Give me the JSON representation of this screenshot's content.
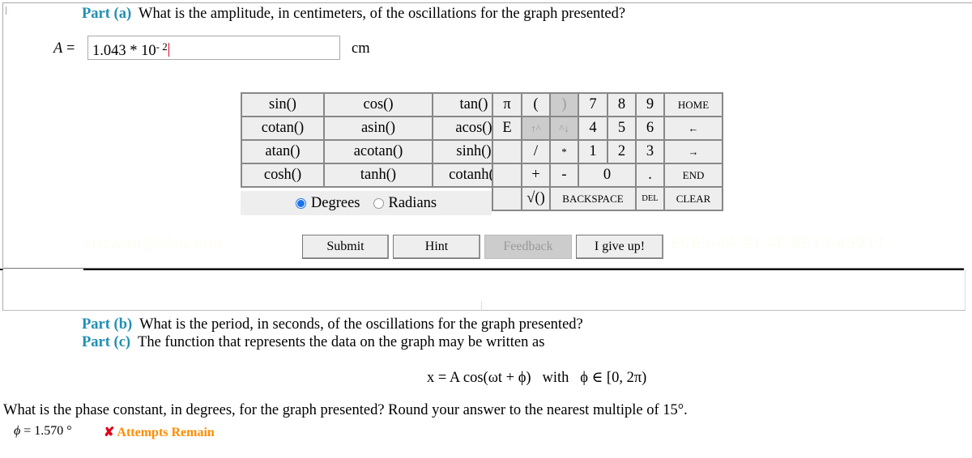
{
  "part_a": {
    "label": "Part (a)",
    "question": "What is the amplitude, in centimeters, of the oscillations for the graph presented?",
    "variable": "A",
    "equals": "=",
    "answer_mantissa": "1.043 * 10",
    "answer_exponent": "- 2",
    "unit": "cm"
  },
  "function_keys": [
    [
      "sin()",
      "cos()",
      "tan()"
    ],
    [
      "cotan()",
      "asin()",
      "acos()"
    ],
    [
      "atan()",
      "acotan()",
      "sinh()"
    ],
    [
      "cosh()",
      "tanh()",
      "cotanh()"
    ]
  ],
  "angle_mode": {
    "options": [
      "Degrees",
      "Radians"
    ],
    "selected": "Degrees"
  },
  "keypad": {
    "pi": "π",
    "open_paren": "(",
    "close_paren": ")",
    "e": "E",
    "up_caret": "↑^",
    "caret_down": "^↓",
    "divide": "/",
    "multiply": "*",
    "plus": "+",
    "minus": "-",
    "sqrt": "√()",
    "backspace": "BACKSPACE",
    "del": "DEL",
    "home": "HOME",
    "left": "←",
    "right": "→",
    "end": "END",
    "clear": "CLEAR",
    "digits": [
      "7",
      "8",
      "9",
      "4",
      "5",
      "6",
      "1",
      "2",
      "3",
      "0"
    ],
    "dot": "."
  },
  "actions": {
    "submit": "Submit",
    "hint": "Hint",
    "feedback": "Feedback",
    "giveup": "I give up!"
  },
  "watermarks": [
    "srizwan@sfsu.edu",
    "6C65-4A-91-4F-8E13-45917"
  ],
  "part_b": {
    "label": "Part (b)",
    "question": "What is the period, in seconds, of the oscillations for the graph presented?"
  },
  "part_c": {
    "label": "Part (c)",
    "question": "The function that represents the data on the graph may be written as",
    "equation": "x = A cos(ωt + ϕ)   with   ϕ ∈ [0, 2π)",
    "question2": "What is the phase constant, in degrees, for the graph presented? Round your answer to the nearest multiple of 15°.",
    "answer_var": "ϕ",
    "answer_value": "= 1.570 °",
    "status_icon": "✘",
    "status_text": "Attempts Remain"
  }
}
